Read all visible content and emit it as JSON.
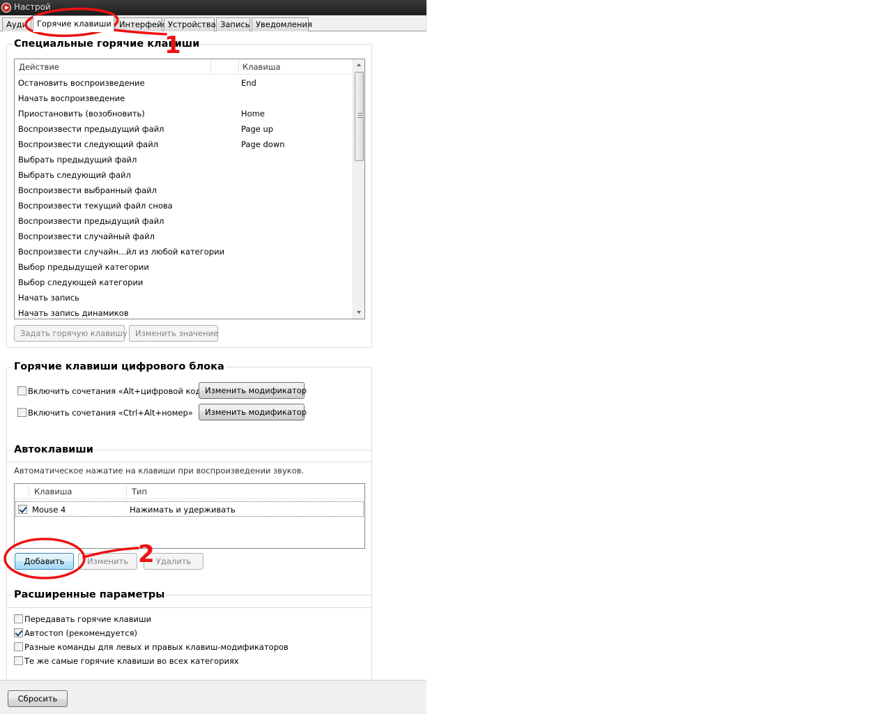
{
  "window": {
    "title": "Настрой"
  },
  "tabs": [
    {
      "label": "Ауди"
    },
    {
      "label": "Горячие клавиши"
    },
    {
      "label": "Интерфейс"
    },
    {
      "label": "Устройства"
    },
    {
      "label": "Запись"
    },
    {
      "label": "Уведомления"
    }
  ],
  "special": {
    "title": "Специальные горячие клавиши",
    "columns": [
      "Действие",
      "Клавиша"
    ],
    "rows": [
      {
        "action": "Остановить воспроизведение",
        "key": "End"
      },
      {
        "action": "Начать воспроизведение",
        "key": ""
      },
      {
        "action": "Приостановить (возобновить)",
        "key": "Home"
      },
      {
        "action": "Воспроизвести предыдущий файл",
        "key": "Page up"
      },
      {
        "action": "Воспроизвести следующий файл",
        "key": "Page down"
      },
      {
        "action": "Выбрать предыдущий файл",
        "key": ""
      },
      {
        "action": "Выбрать следующий файл",
        "key": ""
      },
      {
        "action": "Воспроизвести выбранный файл",
        "key": ""
      },
      {
        "action": "Воспроизвести текущий файл снова",
        "key": ""
      },
      {
        "action": "Воспроизвести предыдущий файл",
        "key": ""
      },
      {
        "action": "Воспроизвести случайный файл",
        "key": ""
      },
      {
        "action": "Воспроизвести случайн...йл из любой категории",
        "key": ""
      },
      {
        "action": "Выбор предыдущей категории",
        "key": ""
      },
      {
        "action": "Выбор следующей категории",
        "key": ""
      },
      {
        "action": "Начать запись",
        "key": ""
      },
      {
        "action": "Начать запись динамиков",
        "key": ""
      }
    ],
    "set_hotkey_label": "Задать горячую клавишу",
    "change_value_label": "Изменить значение"
  },
  "numpad": {
    "title": "Горячие клавиши цифрового блока",
    "alt_label": "Включить сочетания «Alt+цифровой код»",
    "ctrl_label": "Включить сочетания «Ctrl+Alt+номер»",
    "modifier_label": "Изменить модификатор"
  },
  "autokeys": {
    "title": "Автоклавиши",
    "description": "Автоматическое нажатие на клавиши при воспроизведении звуков.",
    "columns": [
      "Клавиша",
      "Тип"
    ],
    "rows": [
      {
        "checked": true,
        "key": "Mouse 4",
        "type": "Нажимать и удерживать"
      }
    ],
    "add_label": "Добавить",
    "edit_label": "Изменить",
    "delete_label": "Удалить"
  },
  "advanced": {
    "title": "Расширенные параметры",
    "options": [
      {
        "label": "Передавать горячие клавиши",
        "checked": false
      },
      {
        "label": "Автостоп (рекомендуется)",
        "checked": true
      },
      {
        "label": "Разные команды для левых и правых клавиш-модификаторов",
        "checked": false
      },
      {
        "label": "Те же самые горячие клавиши во всех категориях",
        "checked": false
      }
    ]
  },
  "footer": {
    "reset_label": "Сбросить"
  },
  "annotations": {
    "marker_1": "1",
    "marker_2": "2",
    "color": "#ee1111"
  }
}
